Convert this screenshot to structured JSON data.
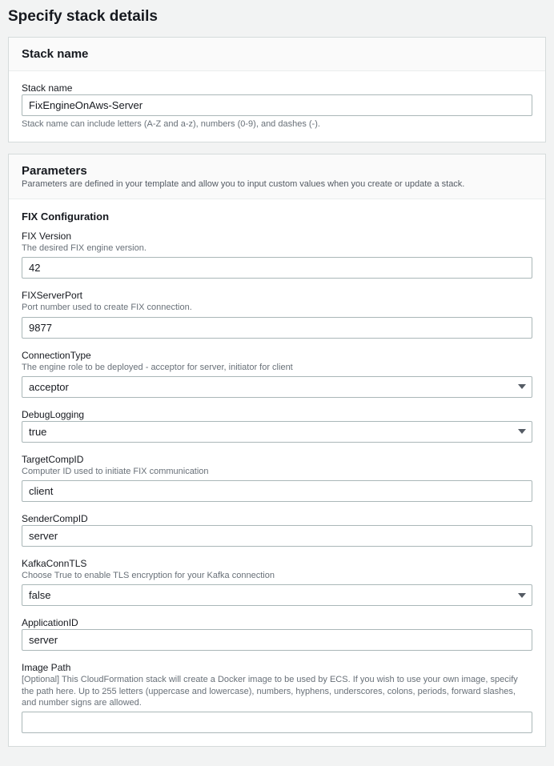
{
  "page": {
    "title": "Specify stack details"
  },
  "stack": {
    "panel_title": "Stack name",
    "label": "Stack name",
    "value": "FixEngineOnAws-Server",
    "hint": "Stack name can include letters (A-Z and a-z), numbers (0-9), and dashes (-)."
  },
  "parameters": {
    "panel_title": "Parameters",
    "panel_subtitle": "Parameters are defined in your template and allow you to input custom values when you create or update a stack.",
    "section_title": "FIX Configuration",
    "fix_version": {
      "label": "FIX Version",
      "desc": "The desired FIX engine version.",
      "value": "42"
    },
    "fix_server_port": {
      "label": "FIXServerPort",
      "desc": "Port number used to create FIX connection.",
      "value": "9877"
    },
    "connection_type": {
      "label": "ConnectionType",
      "desc": "The engine role to be deployed - acceptor for server, initiator for client",
      "value": "acceptor"
    },
    "debug_logging": {
      "label": "DebugLogging",
      "value": "true"
    },
    "target_comp_id": {
      "label": "TargetCompID",
      "desc": "Computer ID used to initiate FIX communication",
      "value": "client"
    },
    "sender_comp_id": {
      "label": "SenderCompID",
      "value": "server"
    },
    "kafka_conn_tls": {
      "label": "KafkaConnTLS",
      "desc": "Choose True to enable TLS encryption for your Kafka connection",
      "value": "false"
    },
    "application_id": {
      "label": "ApplicationID",
      "value": "server"
    },
    "image_path": {
      "label": "Image Path",
      "desc": "[Optional] This CloudFormation stack will create a Docker image to be used by ECS. If you wish to use your own image, specify the path here. Up to 255 letters (uppercase and lowercase), numbers, hyphens, underscores, colons, periods, forward slashes, and number signs are allowed.",
      "value": ""
    }
  }
}
